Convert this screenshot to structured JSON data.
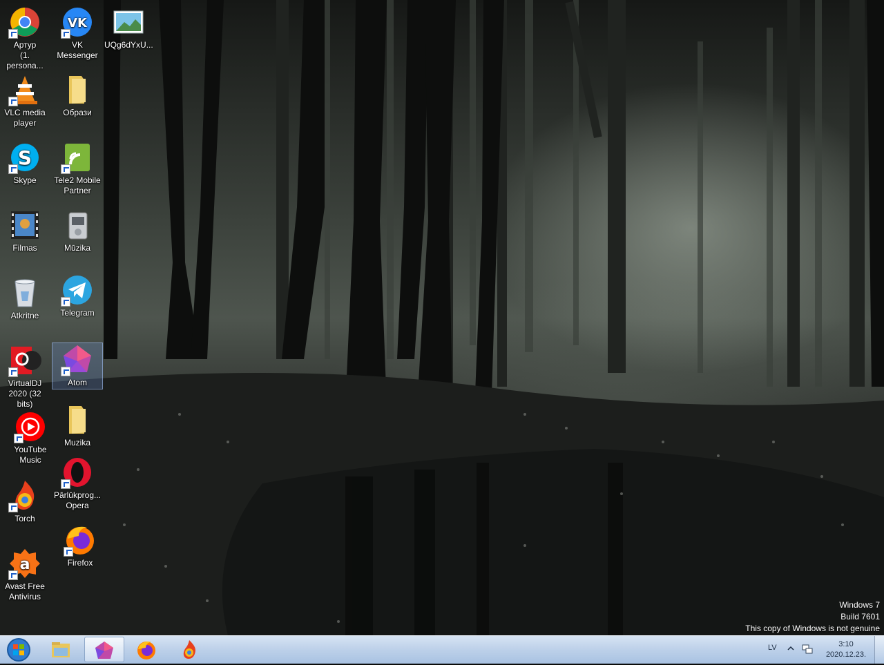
{
  "desktop": {
    "icons": [
      {
        "label": "Артур\n(1. persona...",
        "icon": "chrome-icon"
      },
      {
        "label": "VK\nMessenger",
        "icon": "vk-icon"
      },
      {
        "label": "UQg6dYxU...",
        "icon": "image-file-icon"
      },
      {
        "label": "VLC media\nplayer",
        "icon": "vlc-icon"
      },
      {
        "label": "Образи",
        "icon": "folder-icon"
      },
      {
        "label": "Skype",
        "icon": "skype-icon"
      },
      {
        "label": "Tele2 Mobile\nPartner",
        "icon": "tele2-icon"
      },
      {
        "label": "Filmas",
        "icon": "film-folder-icon"
      },
      {
        "label": "Mūzika",
        "icon": "music-device-icon"
      },
      {
        "label": "Atkritne",
        "icon": "recycle-bin-icon"
      },
      {
        "label": "Telegram",
        "icon": "telegram-icon"
      },
      {
        "label": "VirtualDJ\n2020 (32 bits)",
        "icon": "virtualdj-icon"
      },
      {
        "label": "Atom",
        "icon": "atom-icon"
      },
      {
        "label": "YouTube\nMusic",
        "icon": "youtube-music-icon"
      },
      {
        "label": "Muzika",
        "icon": "folder-icon"
      },
      {
        "label": "Torch",
        "icon": "torch-icon"
      },
      {
        "label": "Pārlūkprog...\nOpera",
        "icon": "opera-icon"
      },
      {
        "label": "Firefox",
        "icon": "firefox-icon"
      },
      {
        "label": "Avast Free\nAntivirus",
        "icon": "avast-icon"
      }
    ]
  },
  "watermark": {
    "line1": "Windows 7",
    "line2": "Build 7601",
    "line3": "This copy of Windows is not genuine"
  },
  "taskbar": {
    "pinned": [
      {
        "name": "explorer",
        "icon": "explorer-icon"
      },
      {
        "name": "atom",
        "icon": "atom-icon",
        "active": true
      },
      {
        "name": "firefox",
        "icon": "firefox-icon"
      },
      {
        "name": "torch",
        "icon": "torch-icon"
      }
    ],
    "tray": {
      "language": "LV",
      "time": "3:10",
      "date": "2020.12.23."
    }
  },
  "colors": {
    "taskbar": "#bfd2ea",
    "selection": "#78a0e6"
  }
}
